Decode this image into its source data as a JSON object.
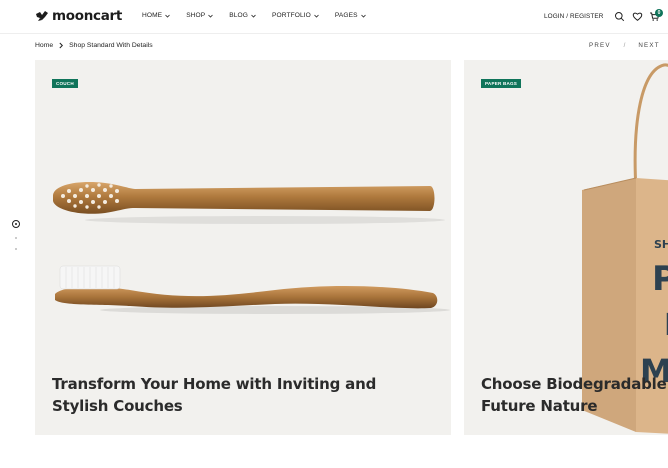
{
  "header": {
    "logo_text": "mooncart",
    "nav": [
      {
        "label": "HOME"
      },
      {
        "label": "SHOP"
      },
      {
        "label": "BLOG"
      },
      {
        "label": "PORTFOLIO"
      },
      {
        "label": "PAGES"
      }
    ],
    "login_label": "LOGIN / REGISTER",
    "cart_count": "0"
  },
  "breadcrumb": {
    "home": "Home",
    "current": "Shop Standard With Details"
  },
  "pager": {
    "prev": "PREV",
    "separator": "/",
    "next": "NEXT"
  },
  "cards": [
    {
      "badge": "COUCH",
      "title_line1": "Transform Your Home with Inviting and",
      "title_line2": "Stylish Couches"
    },
    {
      "badge": "PAPER BAGS",
      "title_line1": "Choose Biodegradable Pa",
      "title_line2": "Future Nature",
      "bag_print": [
        "SHO",
        "PA",
        "I",
        "MO"
      ]
    }
  ],
  "colors": {
    "accent": "#10745a",
    "card_bg": "#f2f1ee",
    "text": "#2b2b2b"
  },
  "icons": {
    "logo": "moon-bird-logo",
    "search": "search-icon",
    "wishlist": "heart-icon",
    "cart": "cart-icon",
    "breadcrumb_separator": "chevron-right-icon"
  }
}
